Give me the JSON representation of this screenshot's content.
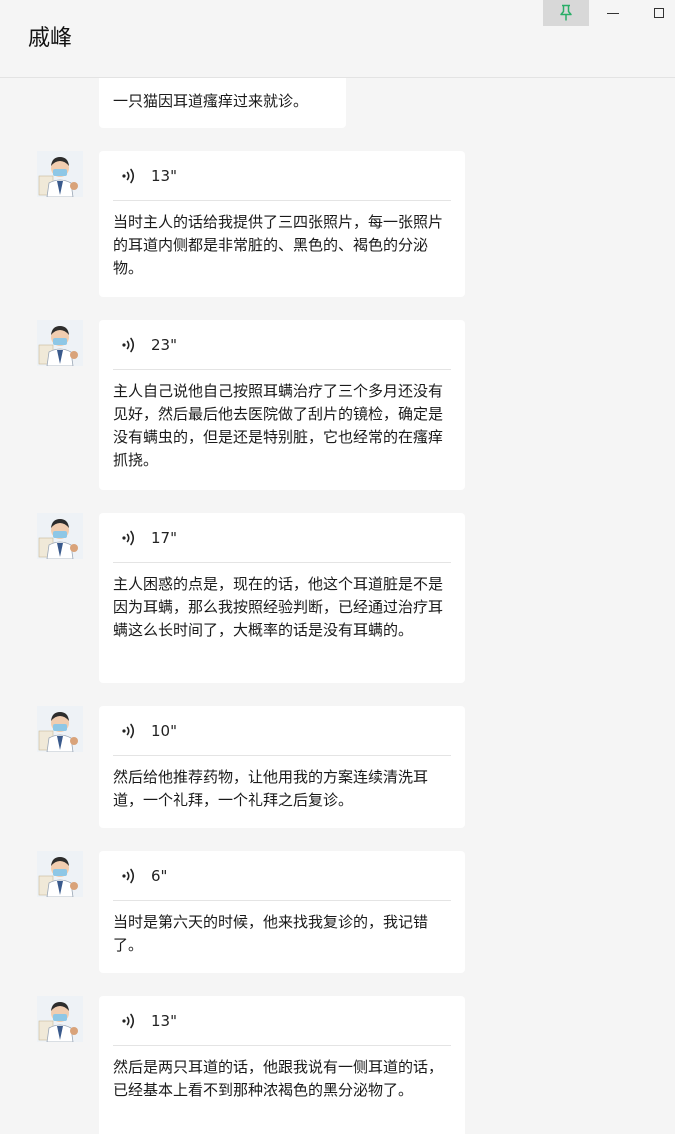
{
  "window": {
    "title": "戚峰",
    "pin_icon": "pin-icon",
    "pin_color": "#2aae67",
    "minimize_icon": "minimize-icon",
    "maximize_icon": "maximize-icon"
  },
  "messages": [
    {
      "type": "text",
      "text": "一只猫因耳道瘙痒过来就诊。"
    },
    {
      "type": "voice",
      "duration": "13\"",
      "text": "当时主人的话给我提供了三四张照片，每一张照片的耳道内侧都是非常脏的、黑色的、褐色的分泌物。"
    },
    {
      "type": "voice",
      "duration": "23\"",
      "text": "主人自己说他自己按照耳螨治疗了三个多月还没有见好，然后最后他去医院做了刮片的镜检，确定是没有螨虫的，但是还是特别脏，它也经常的在瘙痒抓挠。"
    },
    {
      "type": "voice",
      "duration": "17\"",
      "text": "主人困惑的点是，现在的话，他这个耳道脏是不是因为耳螨，那么我按照经验判断，已经通过治疗耳螨这么长时间了，大概率的话是没有耳螨的。"
    },
    {
      "type": "voice",
      "duration": "10\"",
      "text": "然后给他推荐药物，让他用我的方案连续清洗耳道，一个礼拜，一个礼拜之后复诊。"
    },
    {
      "type": "voice",
      "duration": "6\"",
      "text": "当时是第六天的时候，他来找我复诊的，我记错了。"
    },
    {
      "type": "voice",
      "duration": "13\"",
      "text": "然后是两只耳道的话，他跟我说有一侧耳道的话，已经基本上看不到那种浓褐色的黑分泌物了。"
    }
  ]
}
